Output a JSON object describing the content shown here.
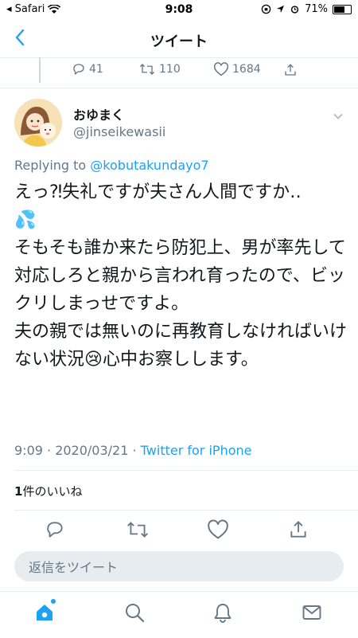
{
  "status_bar": {
    "carrier": "◂ Safari",
    "time": "9:08",
    "battery_text": "71%",
    "battery_level": 0.71
  },
  "nav": {
    "title": "ツイート"
  },
  "previous_tweet": {
    "replies": "41",
    "retweets": "110",
    "likes": "1684"
  },
  "tweet": {
    "name": "おゆまく",
    "handle": "@jinseikewasii",
    "replying_prefix": "Replying to ",
    "replying_to": "@kobutakundayo7",
    "line1": "えっ⁈失礼ですが夫さん人間ですか‥",
    "line1_emoji": "💦",
    "line2": "そもそも誰か来たら防犯上、男が率先して対応しろと親から言われ育ったので、ビックリしまっせですよ。",
    "line3a": "夫の親では無いのに再教育しなければいけない状況",
    "line3_emoji": "😢",
    "line3b": "心中お察しします。",
    "timestamp": "9:09 · 2020/03/21 · ",
    "source": "Twitter for iPhone"
  },
  "likes": {
    "count": "1",
    "label": "件のいいね"
  },
  "reply_bar": {
    "placeholder": "返信をツイート"
  },
  "colors": {
    "accent": "#1da1f2",
    "muted": "#657786",
    "text": "#14171a",
    "border": "#e6ecf0"
  },
  "icons": [
    "back-chevron-icon",
    "reply-icon",
    "retweet-icon",
    "like-icon",
    "share-icon",
    "home-icon",
    "search-icon",
    "notifications-icon",
    "messages-icon"
  ]
}
